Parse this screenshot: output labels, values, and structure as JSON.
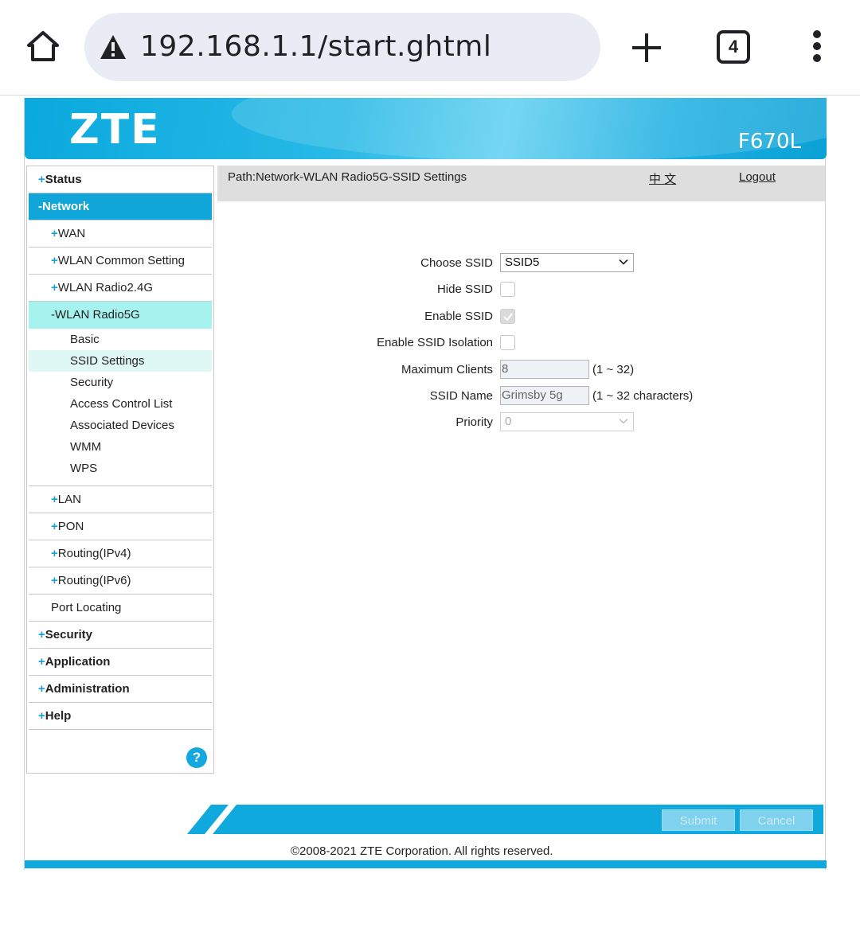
{
  "browser": {
    "url": "192.168.1.1/start.ghtml",
    "tab_count": "4"
  },
  "header": {
    "logo": "ZTE",
    "model": "F670L"
  },
  "sidebar": {
    "status": "Status",
    "network": "Network",
    "wan": "WAN",
    "wlan_common": "WLAN Common Setting",
    "wlan_24": "WLAN Radio2.4G",
    "wlan_5g": "WLAN Radio5G",
    "wlan_5g_items": [
      "Basic",
      "SSID Settings",
      "Security",
      "Access Control List",
      "Associated Devices",
      "WMM",
      "WPS"
    ],
    "lan": "LAN",
    "pon": "PON",
    "routing_v4": "Routing(IPv4)",
    "routing_v6": "Routing(IPv6)",
    "port_locating": "Port Locating",
    "security": "Security",
    "application": "Application",
    "administration": "Administration",
    "help": "Help",
    "help_icon": "?"
  },
  "pathbar": {
    "path": "Path:Network-WLAN Radio5G-SSID Settings",
    "lang": "中 文",
    "logout": "Logout"
  },
  "form": {
    "choose_ssid_label": "Choose SSID",
    "choose_ssid_value": "SSID5",
    "hide_ssid_label": "Hide SSID",
    "enable_ssid_label": "Enable SSID",
    "isolation_label": "Enable SSID Isolation",
    "max_clients_label": "Maximum Clients",
    "max_clients_value": "8",
    "max_clients_hint": "(1 ~ 32)",
    "ssid_name_label": "SSID Name",
    "ssid_name_value": "Grimsby 5g",
    "ssid_name_hint": "(1 ~ 32 characters)",
    "priority_label": "Priority",
    "priority_value": "0"
  },
  "footer": {
    "submit": "Submit",
    "cancel": "Cancel",
    "copyright": "©2008-2021 ZTE Corporation. All rights reserved."
  },
  "colors": {
    "accent": "#10a9de",
    "active_sub": "#a6f2ee",
    "path_bar": "#dedede"
  }
}
